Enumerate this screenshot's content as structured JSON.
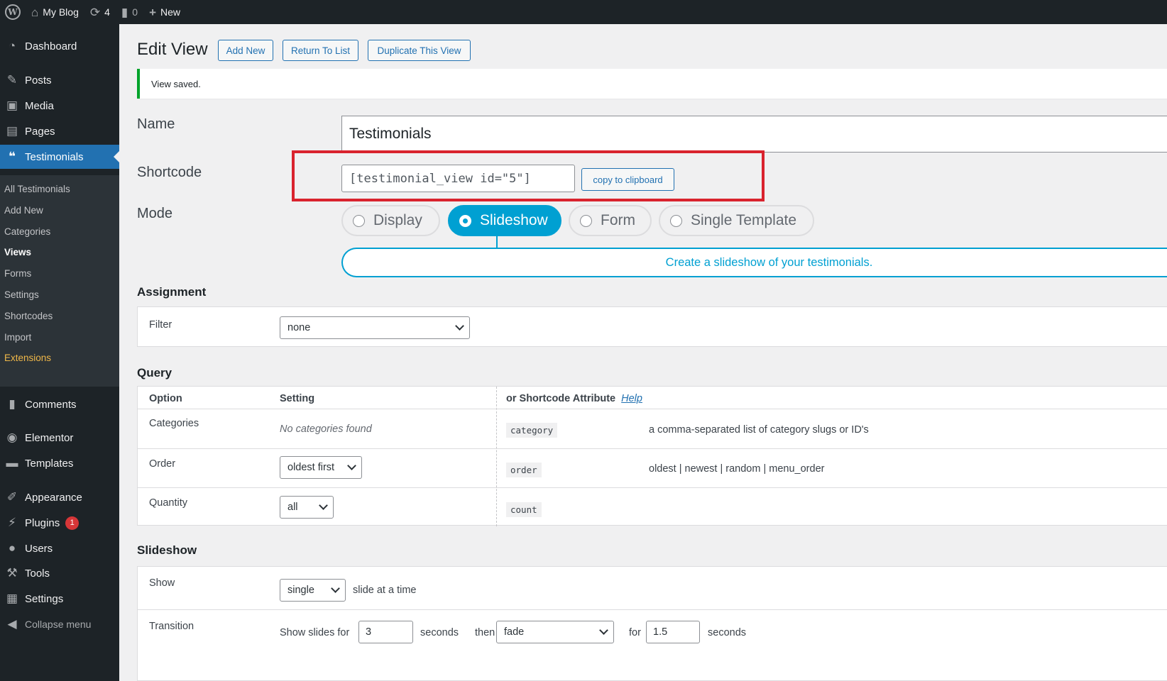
{
  "admin_bar": {
    "site_name": "My Blog",
    "updates_count": "4",
    "comments_count": "0",
    "new_label": "New"
  },
  "sidebar": {
    "items": [
      {
        "label": "Dashboard",
        "icon": "dashboard-icon"
      },
      {
        "label": "Posts",
        "icon": "pin-icon"
      },
      {
        "label": "Media",
        "icon": "media-icon"
      },
      {
        "label": "Pages",
        "icon": "pages-icon"
      },
      {
        "label": "Testimonials",
        "icon": "quote-icon"
      },
      {
        "label": "Comments",
        "icon": "comment-icon"
      },
      {
        "label": "Elementor",
        "icon": "elementor-icon"
      },
      {
        "label": "Templates",
        "icon": "folder-icon"
      },
      {
        "label": "Appearance",
        "icon": "brush-icon"
      },
      {
        "label": "Plugins",
        "icon": "plug-icon",
        "badge": "1"
      },
      {
        "label": "Users",
        "icon": "user-icon"
      },
      {
        "label": "Tools",
        "icon": "wrench-icon"
      },
      {
        "label": "Settings",
        "icon": "settings-icon"
      },
      {
        "label": "Collapse menu",
        "icon": "collapse-icon"
      }
    ],
    "submenu": [
      "All Testimonials",
      "Add New",
      "Categories",
      "Views",
      "Forms",
      "Settings",
      "Shortcodes",
      "Import",
      "Extensions"
    ]
  },
  "header": {
    "title": "Edit View",
    "buttons": [
      "Add New",
      "Return To List",
      "Duplicate This View"
    ]
  },
  "notice": "View saved.",
  "form": {
    "name_label": "Name",
    "name_value": "Testimonials",
    "shortcode_label": "Shortcode",
    "shortcode_value": "[testimonial_view id=\"5\"]",
    "copy_label": "copy to clipboard",
    "mode_label": "Mode",
    "modes": [
      "Display",
      "Slideshow",
      "Form",
      "Single Template"
    ],
    "selected_mode": "Slideshow",
    "mode_description": "Create a slideshow of your testimonials."
  },
  "assignment": {
    "title": "Assignment",
    "filter_label": "Filter",
    "filter_value": "none"
  },
  "query": {
    "title": "Query",
    "headers": {
      "option": "Option",
      "setting": "Setting",
      "attribute": "or Shortcode Attribute",
      "help": "Help"
    },
    "rows": [
      {
        "option": "Categories",
        "setting": "No categories found",
        "attr": "category",
        "desc": "a comma-separated list of category slugs or ID's"
      },
      {
        "option": "Order",
        "setting": "oldest first",
        "attr": "order",
        "desc": "oldest | newest | random | menu_order"
      },
      {
        "option": "Quantity",
        "setting": "all",
        "attr": "count",
        "desc": ""
      }
    ]
  },
  "slideshow": {
    "title": "Slideshow",
    "show_label": "Show",
    "show_value": "single",
    "show_suffix": "slide at a time",
    "transition_label": "Transition",
    "show_slides_for": "Show slides for",
    "seconds_value": "3",
    "seconds_label": "seconds",
    "then_label": "then",
    "transition_value": "fade",
    "for_label": "for",
    "duration_value": "1.5",
    "seconds_label_2": "seconds"
  },
  "colors": {
    "accent": "#2271b1",
    "mode_active": "#00a0d2",
    "highlight": "#d9232e",
    "notice_success": "#00a32a"
  }
}
